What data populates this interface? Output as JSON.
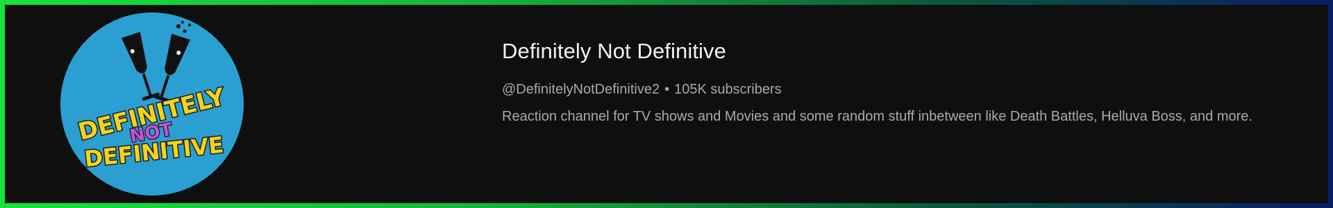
{
  "channel": {
    "name": "Definitely Not Definitive",
    "handle": "@DefinitelyNotDefinitive2",
    "separator": "•",
    "subscribers": "105K subscribers",
    "description": "Reaction channel for TV shows and Movies and some random stuff inbetween like Death Battles, Helluva Boss, and more."
  },
  "avatar": {
    "logo_text_line1": "DEFINITELY",
    "logo_text_line2": "NOT",
    "logo_text_line3": "DEFINITIVE",
    "icon": "champagne-glasses-icon"
  },
  "colors": {
    "background": "#0f0f0f",
    "avatar_bg": "#2b9fd2",
    "logo_yellow": "#f7d21b",
    "logo_purple": "#c94fd8",
    "text_primary": "#f1f1f1",
    "text_secondary": "#aaaaaa",
    "border_start": "#16e33a",
    "border_end": "#0a1b66"
  }
}
